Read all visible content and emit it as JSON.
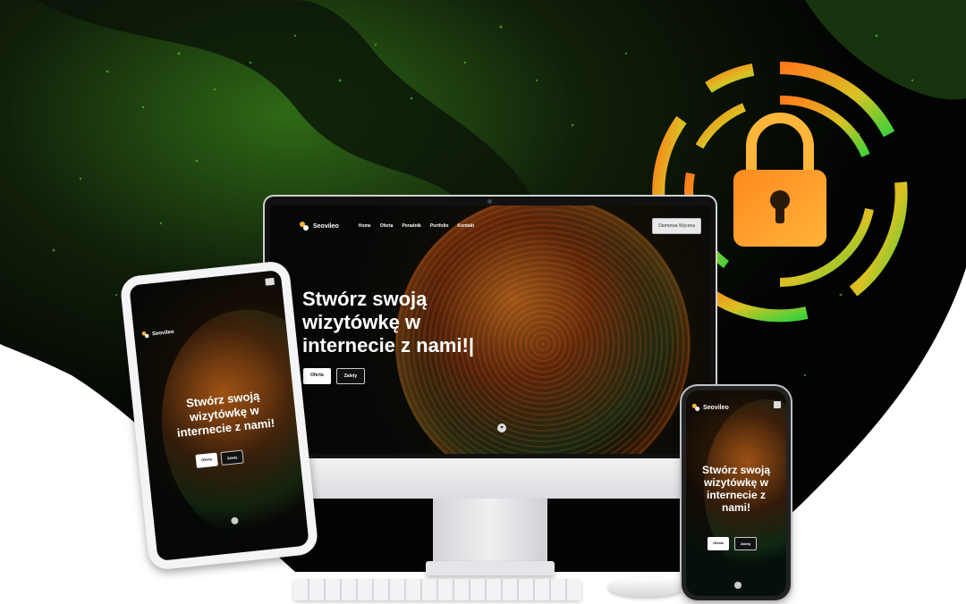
{
  "brand": {
    "name": "Seovileo",
    "accent_orange": "#ff8a1f",
    "accent_green": "#5bd23a"
  },
  "desktop_site": {
    "nav_items": [
      "Home",
      "Oferta",
      "Poradnik",
      "Portfolio",
      "Kontakt"
    ],
    "cta_label": "Darmowa Wycena",
    "hero_title": "Stwórz swoją wizytówkę w internecie z nami!|",
    "button_primary": "Oferta",
    "button_secondary": "Zalety"
  },
  "tablet_site": {
    "hero_title": "Stwórz swoją wizytówkę w internecie z nami!",
    "button_primary": "Oferta",
    "button_secondary": "Zalety"
  },
  "phone_site": {
    "hero_title": "Stwórz swoją wizytówkę w internecie z nami!",
    "button_primary": "Oferta",
    "button_secondary": "Zalety"
  },
  "icons": [
    "padlock-icon",
    "logo-icon",
    "menu-icon",
    "scroll-down-icon"
  ]
}
